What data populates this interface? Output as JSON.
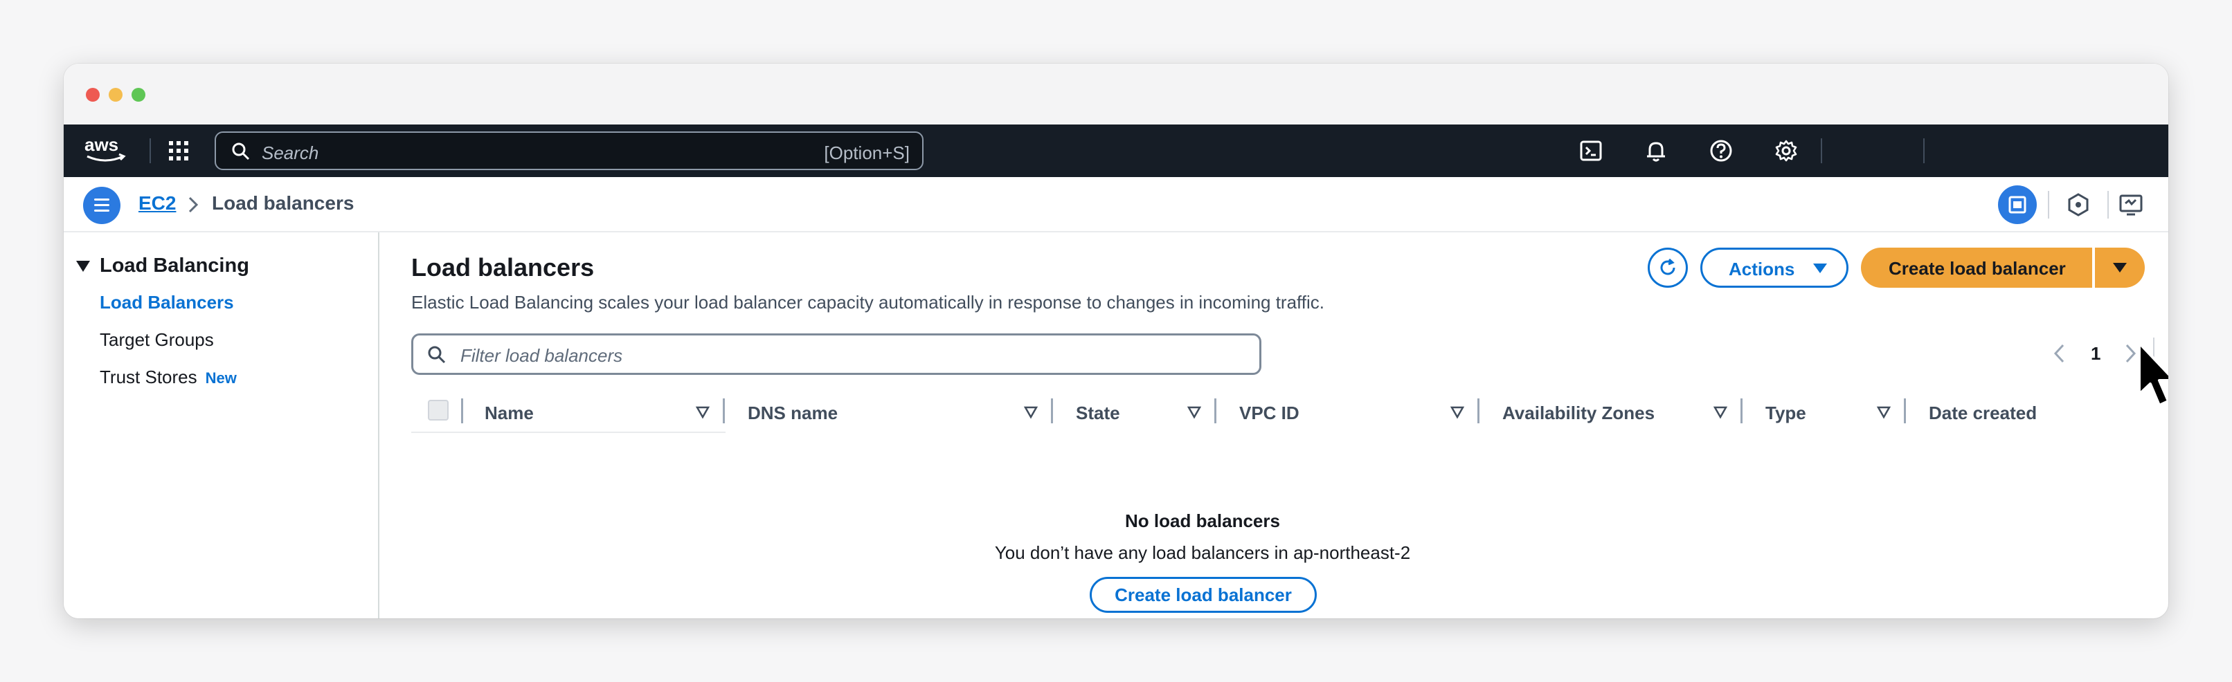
{
  "topnav": {
    "logo_text": "aws",
    "search_placeholder": "Search",
    "search_shortcut": "[Option+S]",
    "icons": [
      "cloudshell-icon",
      "bell-icon",
      "help-icon",
      "gear-icon"
    ]
  },
  "breadcrumb": {
    "items": [
      "EC2",
      "Load balancers"
    ]
  },
  "sidebar": {
    "section": "Load Balancing",
    "items": [
      {
        "label": "Load Balancers",
        "active": true
      },
      {
        "label": "Target Groups",
        "active": false
      },
      {
        "label": "Trust Stores",
        "badge": "New",
        "active": false
      }
    ]
  },
  "main": {
    "title": "Load balancers",
    "description": "Elastic Load Balancing scales your load balancer capacity automatically in response to changes in incoming traffic.",
    "actions_label": "Actions",
    "create_label": "Create load balancer",
    "filter_placeholder": "Filter load balancers",
    "page_number": "1",
    "columns": [
      "Name",
      "DNS name",
      "State",
      "VPC ID",
      "Availability Zones",
      "Type",
      "Date created"
    ],
    "empty_title": "No load balancers",
    "empty_description": "You don’t have any load balancers in ap-northeast-2",
    "empty_button": "Create load balancer"
  },
  "colors": {
    "accent": "#0972d3",
    "primary_button": "#f0a43a",
    "nav_bg": "#161d26"
  }
}
